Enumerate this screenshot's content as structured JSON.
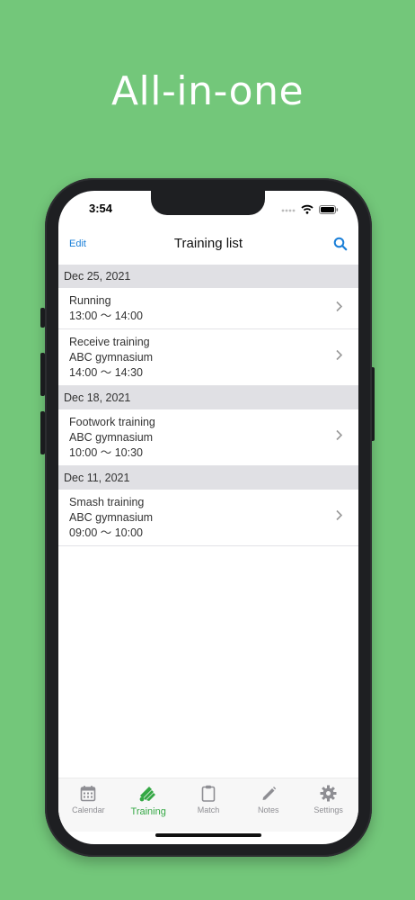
{
  "headline": "All-in-one",
  "status_bar": {
    "time": "3:54"
  },
  "navbar": {
    "edit_label": "Edit",
    "title": "Training list"
  },
  "sections": [
    {
      "date": "Dec 25, 2021",
      "items": [
        {
          "title": "Running",
          "location": "",
          "time": "13:00 〜 14:00"
        },
        {
          "title": "Receive training",
          "location": "ABC gymnasium",
          "time": "14:00 〜 14:30"
        }
      ]
    },
    {
      "date": "Dec 18, 2021",
      "items": [
        {
          "title": "Footwork training",
          "location": "ABC gymnasium",
          "time": "10:00 〜 10:30"
        }
      ]
    },
    {
      "date": "Dec 11, 2021",
      "items": [
        {
          "title": "Smash training",
          "location": "ABC gymnasium",
          "time": "09:00 〜 10:00"
        }
      ]
    }
  ],
  "tabs": [
    {
      "label": "Calendar",
      "icon": "calendar-icon",
      "active": false
    },
    {
      "label": "Training",
      "icon": "shuttlecock-icon",
      "active": true
    },
    {
      "label": "Match",
      "icon": "clipboard-icon",
      "active": false
    },
    {
      "label": "Notes",
      "icon": "pencil-icon",
      "active": false
    },
    {
      "label": "Settings",
      "icon": "gear-icon",
      "active": false
    }
  ],
  "colors": {
    "background": "#73c77a",
    "accent": "#1a7fd8",
    "tab_active": "#35a845"
  }
}
